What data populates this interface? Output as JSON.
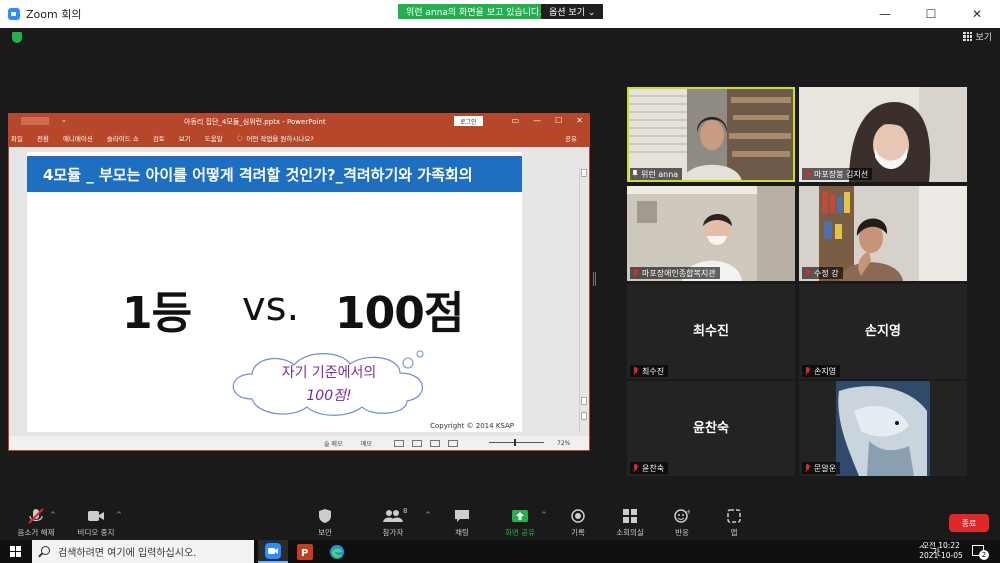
{
  "window": {
    "title": "Zoom 회의",
    "controls": [
      "—",
      "☐",
      "✕"
    ]
  },
  "share_banner": {
    "text": "위런 anna의 화면을 보고 있습니다.",
    "view_options": "옵션 보기 ⌄"
  },
  "view_button": "보기",
  "ppt": {
    "file_title": "아동리 집단_4모듈_심위런.pptx  -  PowerPoint",
    "login": "로그인",
    "menu": [
      "파일",
      "전환",
      "애니메이션",
      "슬라이드 쇼",
      "검토",
      "보기",
      "도움말"
    ],
    "tell_me": "어떤 작업을 원하시나요?",
    "share": "공유",
    "slide": {
      "header": "4모듈 _ 부모는 아이를 어떻게 격려할 것인가?_격려하기와 가족회의",
      "left_phrase": "1등",
      "vs": "vs.",
      "right_phrase": "100점",
      "cloud_line1": "자기 기준에서의",
      "cloud_line2": "100점!",
      "copyright": "Copyright © 2014 KSAP"
    },
    "status": {
      "notes": "슬 메모",
      "memo": "메모",
      "zoom": "72%"
    }
  },
  "participants": [
    {
      "name": "위런 anna",
      "video": true,
      "active": true,
      "pinned": true
    },
    {
      "name": "마포장봉 김지선",
      "video": true
    },
    {
      "name": "마포장애인종합복지관",
      "video": true
    },
    {
      "name": "수정 강",
      "video": true
    },
    {
      "name": "최수진",
      "video": false
    },
    {
      "name": "손지영",
      "video": false
    },
    {
      "name": "윤찬숙",
      "video": false
    },
    {
      "name": "문알운",
      "video": true
    }
  ],
  "toolbar": {
    "mute": "음소거 해제",
    "video": "비디오 중지",
    "security": "보안",
    "participants": "참가자",
    "participants_count": "8",
    "chat": "채팅",
    "share_screen": "화면 공유",
    "record": "기록",
    "breakout": "소회의실",
    "reactions": "반응",
    "apps": "앱",
    "end": "종료"
  },
  "taskbar": {
    "search_placeholder": "검색하려면 여기에 입력하십시오.",
    "time": "오전 10:22",
    "date": "2021-10-05",
    "ime": "가",
    "notifications": "2"
  }
}
